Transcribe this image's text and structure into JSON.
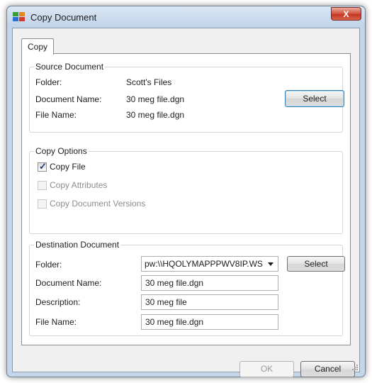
{
  "window": {
    "title": "Copy Document",
    "close_label": "X"
  },
  "tabs": [
    {
      "label": "Copy"
    }
  ],
  "source": {
    "group_title": "Source Document",
    "folder_label": "Folder:",
    "folder_value": "Scott's Files",
    "docname_label": "Document Name:",
    "docname_value": "30 meg file.dgn",
    "filename_label": "File Name:",
    "filename_value": "30 meg file.dgn",
    "select_label": "Select"
  },
  "options": {
    "group_title": "Copy Options",
    "items": [
      {
        "label": "Copy File",
        "checked": true,
        "enabled": true
      },
      {
        "label": "Copy Attributes",
        "checked": false,
        "enabled": false
      },
      {
        "label": "Copy Document Versions",
        "checked": false,
        "enabled": false
      }
    ]
  },
  "destination": {
    "group_title": "Destination Document",
    "folder_label": "Folder:",
    "folder_value": "pw:\\\\HQOLYMAPPPWV8IP.WS",
    "docname_label": "Document Name:",
    "docname_value": "30 meg file.dgn",
    "description_label": "Description:",
    "description_value": "30 meg file",
    "filename_label": "File Name:",
    "filename_value": "30 meg file.dgn",
    "select_label": "Select"
  },
  "footer": {
    "ok_label": "OK",
    "cancel_label": "Cancel"
  }
}
